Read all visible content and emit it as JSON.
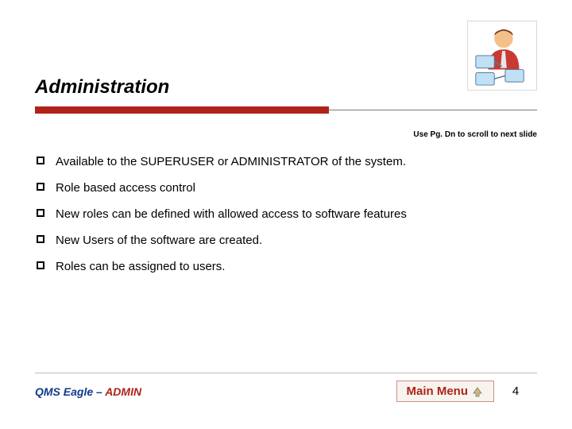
{
  "header": {
    "title": "Administration",
    "icon_name": "admin-user-icon"
  },
  "hint": "Use Pg. Dn to scroll to next slide",
  "bullets": [
    "Available to the SUPERUSER or ADMINISTRATOR of the system.",
    "Role based access control",
    "New roles can be defined with allowed access to software features",
    "New Users of the software are created.",
    "Roles can be assigned to users."
  ],
  "footer": {
    "product_prefix": "QMS Eagle – ",
    "product_suffix": "ADMIN",
    "main_menu_label": "Main Menu",
    "page_number": "4"
  }
}
